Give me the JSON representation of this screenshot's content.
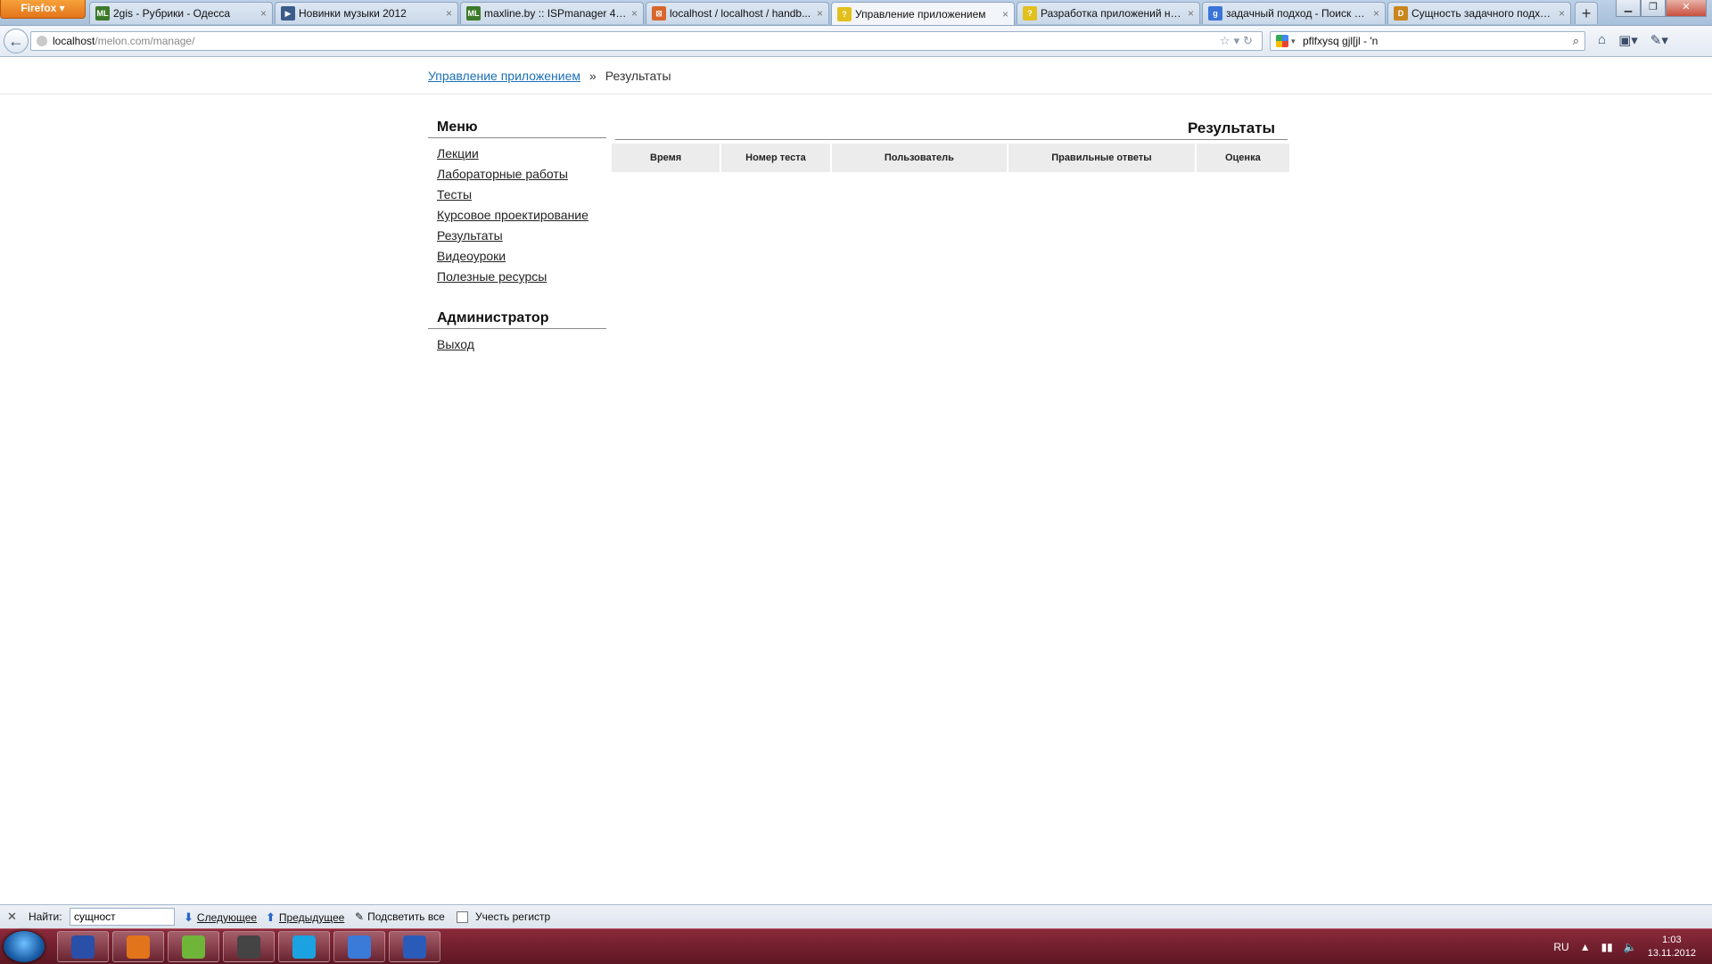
{
  "browser": {
    "firefox_label": "Firefox",
    "tabs": [
      {
        "title": "2gis - Рубрики - Одесса",
        "fav": "ML",
        "fav_color": "#3c7a2a"
      },
      {
        "title": "Новинки музыки 2012",
        "fav": "▶",
        "fav_color": "#3b5b8a"
      },
      {
        "title": "maxline.by :: ISPmanager 4.4 ...",
        "fav": "ML",
        "fav_color": "#3c7a2a"
      },
      {
        "title": "localhost / localhost / handb...",
        "fav": "⊠",
        "fav_color": "#d9652b"
      },
      {
        "title": "Управление приложением",
        "fav": "?",
        "fav_color": "#e2c01d",
        "active": true
      },
      {
        "title": "Разработка приложений на ...",
        "fav": "?",
        "fav_color": "#e2c01d"
      },
      {
        "title": "задачный подход - Поиск в ...",
        "fav": "g",
        "fav_color": "#3b74d8"
      },
      {
        "title": "Сущность задачного подход...",
        "fav": "D",
        "fav_color": "#c8861d"
      }
    ],
    "tab_close": "×",
    "new_tab": "+",
    "url_host": "localhost",
    "url_path": "/melon.com/manage/",
    "search_text": "pflfxysq gjl[jl - 'n"
  },
  "page": {
    "breadcrumb": {
      "link": "Управление приложением",
      "separator": "»",
      "current": "Результаты"
    },
    "menu_title": "Меню",
    "menu_items": [
      "Лекции",
      "Лабораторные работы",
      "Тесты",
      "Курсовое проектирование",
      "Результаты",
      "Видеоуроки",
      "Полезные ресурсы"
    ],
    "admin_title": "Администратор",
    "admin_items": [
      "Выход"
    ],
    "results_title": "Результаты",
    "table_headers": [
      "Время",
      "Номер теста",
      "Пользователь",
      "Правильные ответы",
      "Оценка"
    ]
  },
  "findbar": {
    "label": "Найти:",
    "value": "сущност",
    "next": "Следующее",
    "prev": "Предыдущее",
    "highlight": "Подсветить все",
    "match_case": "Учесть регистр"
  },
  "taskbar": {
    "apps": [
      {
        "name": "save-app",
        "color": "#2a4fa8"
      },
      {
        "name": "firefox-app",
        "color": "#e2741b"
      },
      {
        "name": "notepad-app",
        "color": "#6fb53a"
      },
      {
        "name": "video-app",
        "color": "#444444"
      },
      {
        "name": "skype-app",
        "color": "#1aa3e0"
      },
      {
        "name": "itunes-app",
        "color": "#3a7ad8"
      },
      {
        "name": "word-app",
        "color": "#2b5bb8"
      }
    ],
    "lang": "RU",
    "time": "1:03",
    "date": "13.11.2012"
  }
}
